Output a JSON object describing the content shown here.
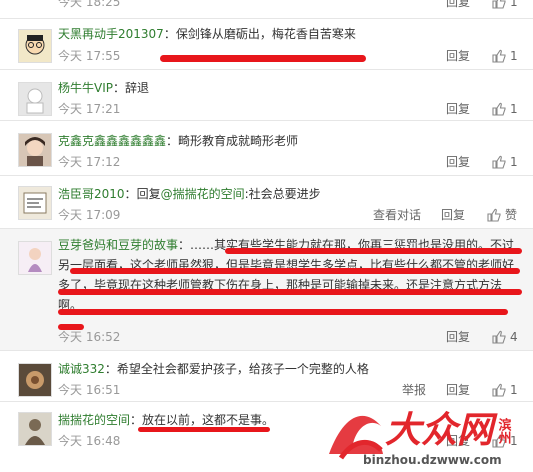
{
  "colors": {
    "username": "#2f7d2f",
    "text": "#333333",
    "meta": "#999999",
    "annotation": "#e8161b",
    "watermark": "#e2262c"
  },
  "top_partial": {
    "time": "今天 18:25",
    "reply": "回复",
    "likes": "1"
  },
  "comments": [
    {
      "user": "天黑再动手201307",
      "text": "保剑锋从磨砺出，梅花香自苦寒来",
      "time": "今天 17:55",
      "reply": "回复",
      "likes": "1"
    },
    {
      "user": "杨牛牛VIP",
      "text": "辞退",
      "time": "今天 17:21",
      "reply": "回复",
      "likes": "1"
    },
    {
      "user": "克鑫克鑫鑫鑫鑫鑫鑫",
      "text": "畸形教育成就畸形老师",
      "time": "今天 17:12",
      "reply": "回复",
      "likes": "1"
    },
    {
      "user": "浩臣哥2010",
      "reply_prefix": "回复",
      "reply_to": "@揣揣花的空间",
      "text": ":社会总要进步",
      "time": "今天 17:09",
      "view_dialog": "查看对话",
      "reply": "回复",
      "likes": "赞"
    },
    {
      "user": "豆芽爸妈和豆芽的故事",
      "text": "……其实有些学生能力就在那，你再三惩罚也是没用的。不过另一层面看，这个老师虽然狠，但是毕竟是想学生多学点，比有些什么都不管的老师好多了，毕竟现在这种老师管教下伤在身上，那种是可能输掉未来。还是注意方式方法啊。",
      "time": "今天 16:52",
      "reply": "回复",
      "likes": "4"
    },
    {
      "user": "诚诚332",
      "text": "希望全社会都爱护孩子，给孩子一个完整的人格",
      "time": "今天 16:51",
      "report": "举报",
      "reply": "回复",
      "likes": "1"
    },
    {
      "user": "揣揣花的空间",
      "text": "放在以前，这都不是事。",
      "time": "今天 16:48",
      "reply": "回复",
      "likes": "1"
    }
  ],
  "icons": {
    "thumb": "thumbs-up-icon"
  },
  "watermark": {
    "brand": "大众网",
    "region": "滨州",
    "url": "binzhou.dzwww.com"
  }
}
